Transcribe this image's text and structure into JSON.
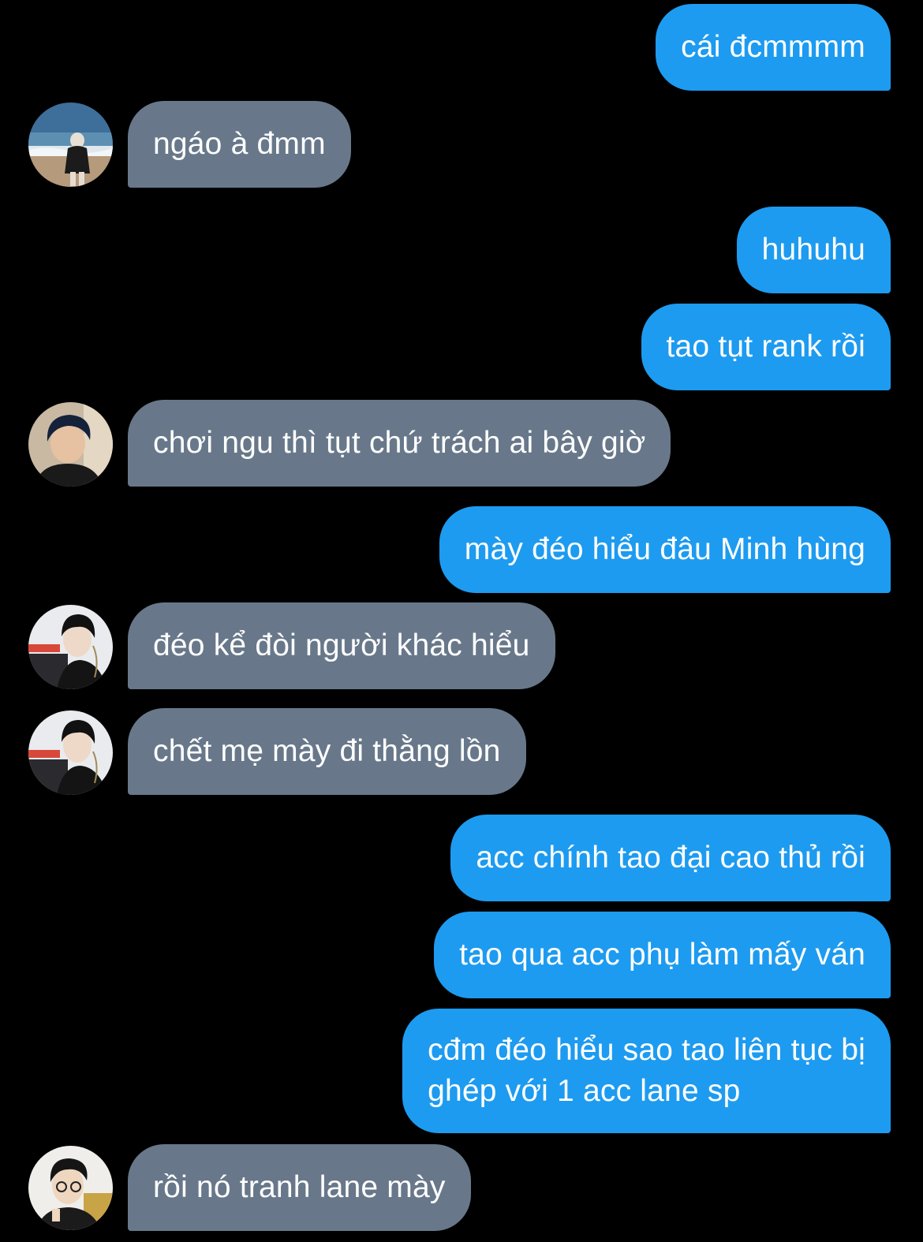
{
  "thread": {
    "messages": [
      {
        "sender": "me",
        "text": "cái đcmmmm"
      },
      {
        "sender": "them",
        "avatar": "avatar-beach",
        "text": "ngáo à đmm"
      },
      {
        "sender": "me",
        "text": "huhuhu"
      },
      {
        "sender": "me",
        "text": "tao tụt rank rồi"
      },
      {
        "sender": "them",
        "avatar": "avatar-boy-dark-hair",
        "text": "chơi ngu thì tụt chứ trách ai bây giờ"
      },
      {
        "sender": "me",
        "text": "mày đéo hiểu đâu Minh hùng"
      },
      {
        "sender": "them",
        "avatar": "avatar-esports-player",
        "text": "đéo kể đòi người khác hiểu"
      },
      {
        "sender": "them",
        "avatar": "avatar-esports-player",
        "text": "chết mẹ mày đi thằng lồn"
      },
      {
        "sender": "me",
        "text": "acc chính tao đại cao thủ rồi"
      },
      {
        "sender": "me",
        "text": "tao qua acc phụ làm mấy ván"
      },
      {
        "sender": "me",
        "text": "cđm đéo hiểu sao tao liên tục bị\nghép với 1 acc lane sp"
      },
      {
        "sender": "them",
        "avatar": "avatar-glasses-player",
        "text": "rồi nó tranh lane mày"
      }
    ]
  },
  "colors": {
    "background": "#000000",
    "outgoing_bubble": "#1d9bf0",
    "incoming_bubble": "#68788a",
    "text": "#ffffff"
  }
}
